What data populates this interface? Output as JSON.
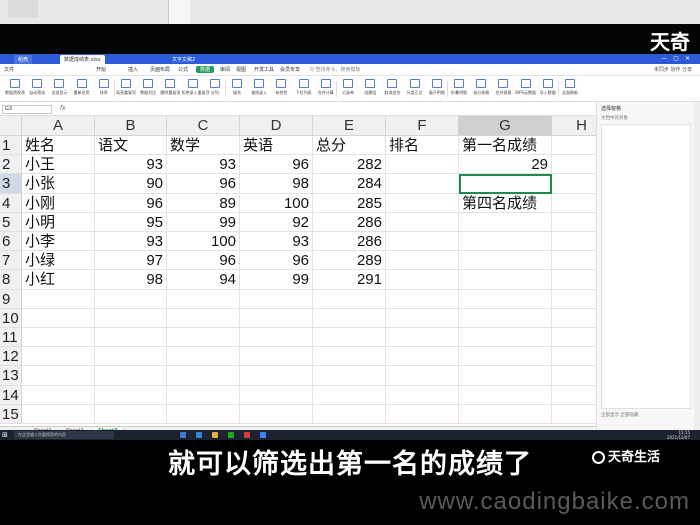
{
  "top_logo": "天奇",
  "app_tabs": [
    {
      "label": "稻壳",
      "kind": "home"
    },
    {
      "label": "数据成绩表.xlsx",
      "kind": "active"
    },
    {
      "label": "文字文稿2",
      "kind": "normal"
    }
  ],
  "menu": {
    "file": "文件",
    "items": [
      "开始",
      "插入",
      "页面布局",
      "公式",
      "数据",
      "审阅",
      "视图",
      "开发工具",
      "会员专享"
    ],
    "active_item": "数据",
    "search_hint": "Q 查找命令、搜索模板",
    "right": "未同步  协作  分享"
  },
  "toolbar": [
    "数据透视表",
    "自动筛选",
    "全部显示",
    "重新应用",
    "排序",
    "高亮重复项",
    "数据对比",
    "删除重复项",
    "拒绝录入重复项",
    "分列",
    "填充",
    "查找录入",
    "有效性",
    "下拉列表",
    "合并计算",
    "记录单",
    "创建组",
    "取消组合",
    "分类汇总",
    "展开明细",
    "折叠明细",
    "拆分表格",
    "合并表格",
    "WPS云数据",
    "导入数据",
    "全部刷新"
  ],
  "formula_bar": {
    "name_box": "G3",
    "fx": "fx",
    "value": ""
  },
  "columns": [
    "A",
    "B",
    "C",
    "D",
    "E",
    "F",
    "G",
    "H"
  ],
  "rows": [
    "1",
    "2",
    "3",
    "4",
    "5",
    "6",
    "7",
    "8",
    "9",
    "10",
    "11",
    "12",
    "13",
    "14",
    "15"
  ],
  "selected_column": "G",
  "selected_row": "3",
  "headers": {
    "A": "姓名",
    "B": "语文",
    "C": "数学",
    "D": "英语",
    "E": "总分",
    "F": "排名",
    "G": "第一名成绩"
  },
  "students": [
    {
      "name": "小王",
      "chinese": "93",
      "math": "93",
      "english": "96",
      "total": "282"
    },
    {
      "name": "小张",
      "chinese": "90",
      "math": "96",
      "english": "98",
      "total": "284"
    },
    {
      "name": "小刚",
      "chinese": "96",
      "math": "89",
      "english": "100",
      "total": "285"
    },
    {
      "name": "小明",
      "chinese": "95",
      "math": "99",
      "english": "92",
      "total": "286"
    },
    {
      "name": "小李",
      "chinese": "93",
      "math": "100",
      "english": "93",
      "total": "286"
    },
    {
      "name": "小绿",
      "chinese": "97",
      "math": "96",
      "english": "96",
      "total": "289"
    },
    {
      "name": "小红",
      "chinese": "98",
      "math": "94",
      "english": "99",
      "total": "291"
    }
  ],
  "g2_value": "29",
  "g4_label": "第四名成绩",
  "sheets": [
    "Sheet1",
    "Sheet2",
    "Sheet3"
  ],
  "active_sheet": "Sheet3",
  "task_pane": {
    "title": "选择窗格",
    "subtitle": "文档中的对象",
    "footer": "全部显示  全部隐藏"
  },
  "taskbar": {
    "search": "在这里输入你要搜索的内容",
    "time": "15:15",
    "date": "2021/12/07"
  },
  "caption": "就可以筛选出第一名的成绩了",
  "brand": "天奇生活",
  "watermark": "www.caodingbaike.com"
}
